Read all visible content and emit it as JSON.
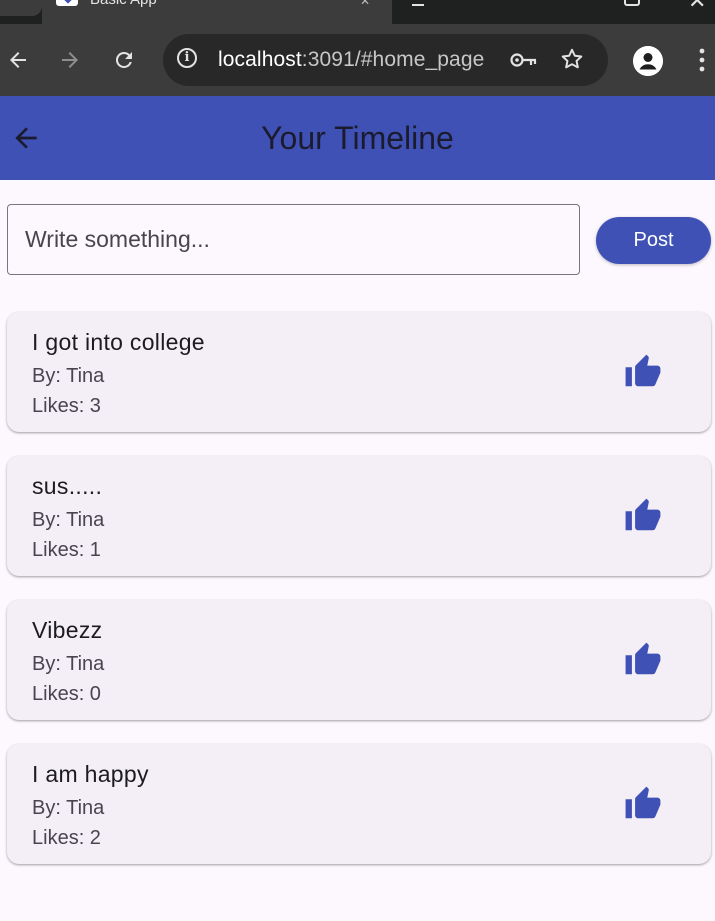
{
  "browser": {
    "tab_title": "Basic App",
    "url_host": "localhost",
    "url_rest": ":3091/#home_page"
  },
  "app_bar": {
    "title": "Your Timeline",
    "accent": "#3f51b5"
  },
  "composer": {
    "placeholder": "Write something...",
    "value": "",
    "post_label": "Post"
  },
  "posts": [
    {
      "text": "I got into college",
      "author": "By: Tina",
      "likes": "Likes: 3"
    },
    {
      "text": "sus.....",
      "author": "By: Tina",
      "likes": "Likes: 1"
    },
    {
      "text": "Vibezz",
      "author": "By: Tina",
      "likes": "Likes: 0"
    },
    {
      "text": "I am happy",
      "author": "By: Tina",
      "likes": "Likes: 2"
    }
  ],
  "icons": {
    "back": "arrow-back-icon",
    "like": "thumb-up-icon"
  }
}
